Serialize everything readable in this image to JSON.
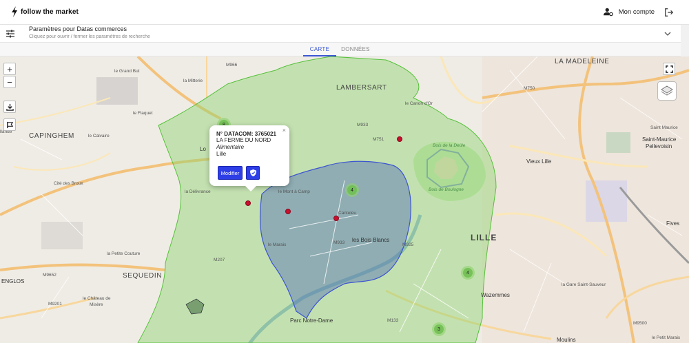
{
  "header": {
    "logo_text": "follow the market",
    "account_label": "Mon compte"
  },
  "params": {
    "title": "Paramètres pour Datas commerces",
    "subtitle": "Cliquez pour ouvrir / fermer les paramètres de recherche"
  },
  "tabs": [
    {
      "label": "CARTE",
      "active": true
    },
    {
      "label": "DONNÉES",
      "active": false
    }
  ],
  "colors": {
    "accent": "#3b58d4",
    "button": "#2d3ee6",
    "zone_green": "#8fd46e",
    "zone_blue": "#4f6fb8",
    "marker": "#c8102e"
  },
  "map": {
    "places": {
      "la_madeleine": "LA MADELEINE",
      "lambersart": "LAMBERSART",
      "capinghem": "CAPINGHEM",
      "sequedin": "SEQUEDIN",
      "lille": "LILLE",
      "englos": "ENGLOS",
      "saint_maurice": "Saint-Maurice",
      "pellevoisin": "Pellevoisin",
      "vieux_lille": "Vieux Lille",
      "fives": "Fives",
      "le_grand_but": "le Grand But",
      "la_mitterie": "la Mitterie",
      "le_flaquet": "le Flaquet",
      "le_calvaire": "le Calvaire",
      "cite_des_broux": "Cité des Broux",
      "la_delivrance": "la Délivrance",
      "le_canon_dor": "le Canon d'Or",
      "le_mont_a_camp": "le Mont à Camp",
      "canteleu": "Canteleu",
      "les_bois_blancs": "les Bois Blancs",
      "le_marais": "le Marais",
      "la_petite_couture": "la Petite Couture",
      "le_chateau_de_misere_1": "le Château de",
      "le_chateau_de_misere_2": "Misère",
      "parc_notre_dame": "Parc Notre-Dame",
      "wazemmes": "Wazemmes",
      "la_gare_saint_sauveur": "la Gare Saint-Sauveur",
      "moulins": "Moulins",
      "le_petit_marais": "le Petit Marais",
      "lomme_partial": "Lo",
      "lillande_partial": "llande",
      "bois_de_la_deule": "Bois de la Deûle",
      "bois_de_boulogne": "Bois de Boulogne",
      "saint_maurice_2": "Saint Maurice"
    },
    "roads": {
      "m9666": "M966",
      "m9652": "M9652",
      "m933": "M933",
      "m751": "M751",
      "m750": "M750",
      "m9201": "M9201",
      "m9500": "M9500",
      "m207": "M207",
      "m925": "M925",
      "m133": "M133",
      "m933b": "M933"
    },
    "clusters": [
      {
        "count": "8"
      },
      {
        "count": "4"
      },
      {
        "count": "4"
      },
      {
        "count": "3"
      }
    ],
    "zoom_in": "+",
    "zoom_out": "−"
  },
  "popup": {
    "title": "N° DATACOM: 3765021",
    "name": "LA FERME DU NORD",
    "category": "Alimentaire",
    "city": "Lille",
    "modify_label": "Modifier",
    "close_glyph": "×"
  }
}
